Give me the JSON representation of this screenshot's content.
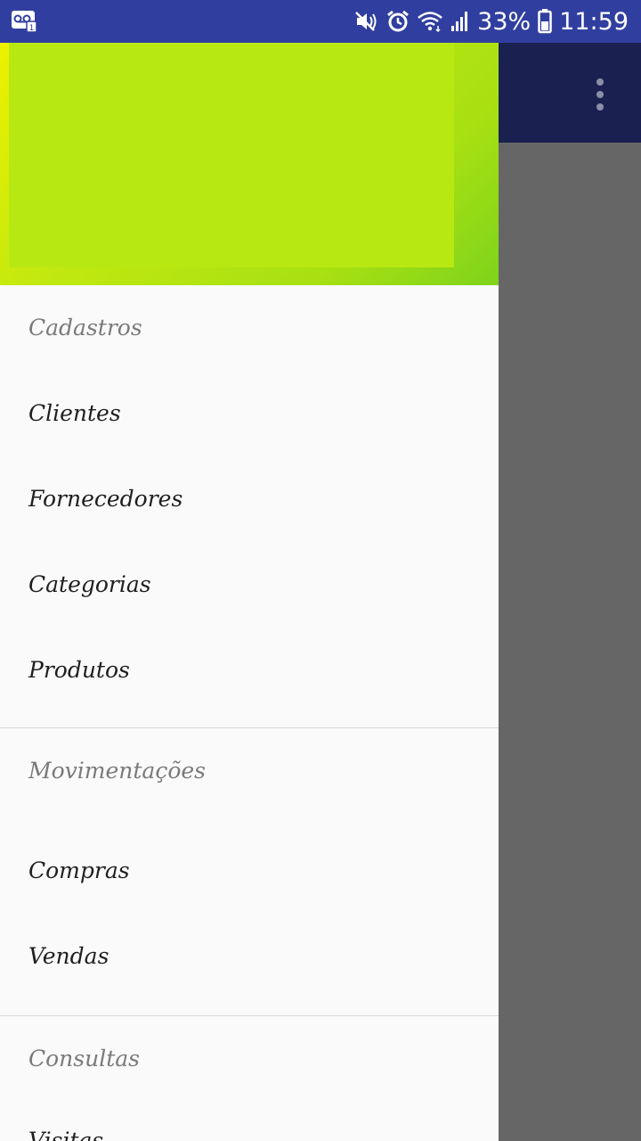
{
  "status_bar": {
    "battery": "33%",
    "time": "11:59",
    "icons": [
      "voicemail-icon",
      "mute-icon",
      "alarm-icon",
      "wifi-icon",
      "signal-icon",
      "battery-icon"
    ]
  },
  "colors": {
    "status_bar": "#303f9f",
    "app_bar": "#1a2150",
    "drawer_header": "#b8e812",
    "scrim": "#666666"
  },
  "app_bar": {
    "overflow_icon": "more-vert-icon"
  },
  "drawer": {
    "sections": [
      {
        "title": "Cadastros",
        "items": [
          "Clientes",
          "Fornecedores",
          "Categorias",
          "Produtos"
        ]
      },
      {
        "title": "Movimentações",
        "items": [
          "Compras",
          "Vendas"
        ]
      },
      {
        "title": "Consultas",
        "items": [
          "Visitas"
        ]
      }
    ]
  }
}
